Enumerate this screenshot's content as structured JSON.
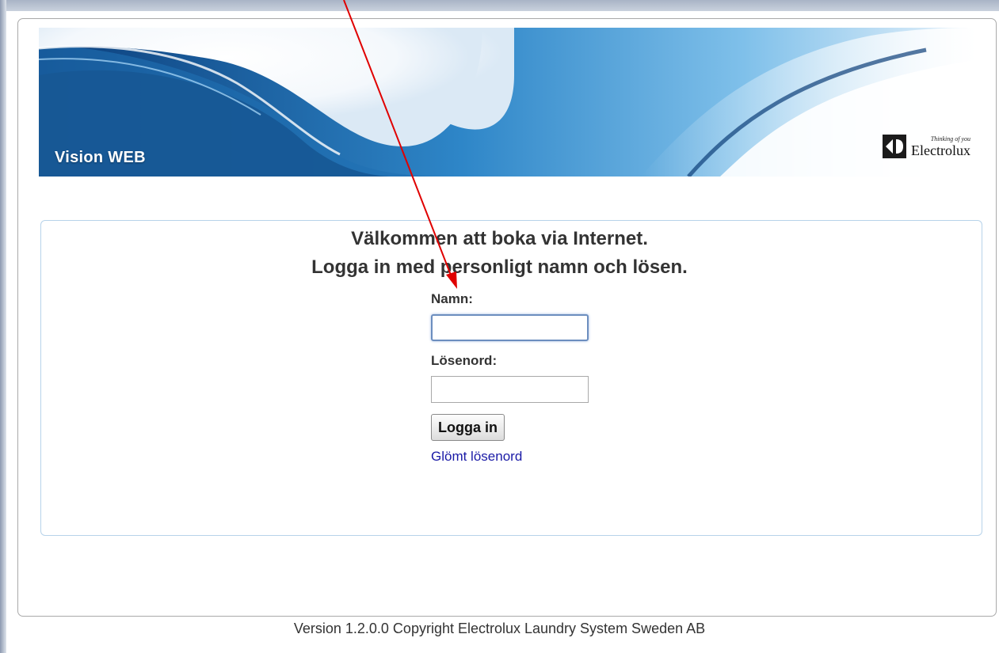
{
  "banner": {
    "title": "Vision WEB",
    "brand_tagline": "Thinking of you",
    "brand_name": "Electrolux"
  },
  "login": {
    "welcome_line1": "Välkommen att boka via Internet.",
    "welcome_line2": "Logga in med personligt namn och lösen.",
    "name_label": "Namn:",
    "name_value": "",
    "password_label": "Lösenord:",
    "password_value": "",
    "submit_label": "Logga in",
    "forgot_link": "Glömt lösenord"
  },
  "footer": {
    "text": "Version 1.2.0.0 Copyright Electrolux Laundry System Sweden AB"
  },
  "colors": {
    "banner_blue": "#2f7fc4",
    "link": "#1a1aa6",
    "box_border": "#b7d3ea",
    "annotation_arrow": "#e00000"
  }
}
